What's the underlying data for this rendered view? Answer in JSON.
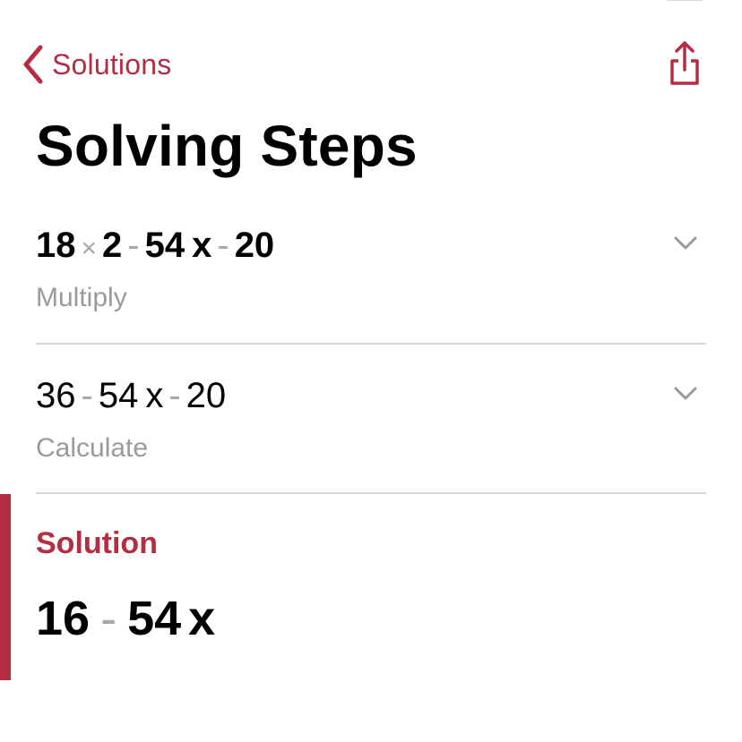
{
  "nav": {
    "back_label": "Solutions",
    "back_icon": "chevron-left-icon",
    "share_icon": "share-icon",
    "accent_color": "#b52d43"
  },
  "page": {
    "title": "Solving Steps"
  },
  "steps": [
    {
      "tokens": [
        "18",
        "×",
        "2",
        "-",
        "54",
        "x",
        "-",
        "20"
      ],
      "description": "Multiply",
      "expand_icon": "chevron-down-icon"
    },
    {
      "tokens": [
        "36",
        "-",
        "54",
        "x",
        "-",
        "20"
      ],
      "description": "Calculate",
      "expand_icon": "chevron-down-icon"
    }
  ],
  "solution": {
    "label": "Solution",
    "tokens": [
      "16",
      "-",
      "54",
      "x"
    ]
  }
}
